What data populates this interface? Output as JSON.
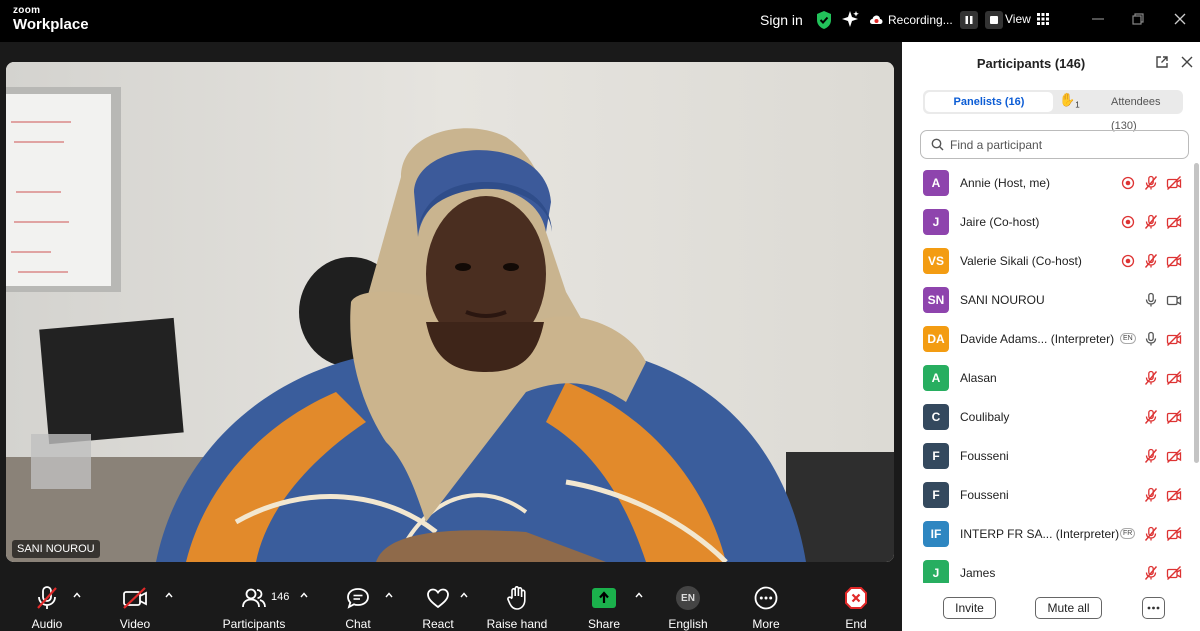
{
  "app": {
    "brand_small": "zoom",
    "brand_large": "Workplace"
  },
  "topbar": {
    "sign_in": "Sign in",
    "recording": "Recording...",
    "view": "View"
  },
  "video": {
    "speaker_name": "SANI NOUROU"
  },
  "toolbar": {
    "audio": "Audio",
    "video": "Video",
    "participants": "Participants",
    "participant_count": "146",
    "chat": "Chat",
    "react": "React",
    "raise_hand": "Raise hand",
    "share": "Share",
    "language_code": "EN",
    "language": "English",
    "more": "More",
    "end": "End"
  },
  "panel": {
    "title": "Participants (146)",
    "tab_panelists": "Panelists (16)",
    "raised_count": "1",
    "tab_attendees": "Attendees (130)",
    "search_placeholder": "Find a participant",
    "invite": "Invite",
    "mute_all": "Mute all",
    "participants": [
      {
        "initials": "A",
        "name": "Annie (Host, me)",
        "color": "#8e44ad",
        "lang": "",
        "rec": true,
        "mic": "muted",
        "cam": "off"
      },
      {
        "initials": "J",
        "name": "Jaire (Co-host)",
        "color": "#8e44ad",
        "lang": "",
        "rec": true,
        "mic": "muted",
        "cam": "off"
      },
      {
        "initials": "VS",
        "name": "Valerie Sikali (Co-host)",
        "color": "#f39c12",
        "lang": "",
        "rec": true,
        "mic": "muted",
        "cam": "off"
      },
      {
        "initials": "SN",
        "name": "SANI NOUROU",
        "color": "#8e44ad",
        "lang": "",
        "rec": false,
        "mic": "on",
        "cam": "on"
      },
      {
        "initials": "DA",
        "name": "Davide Adams...  (Interpreter)",
        "color": "#f39c12",
        "lang": "EN",
        "rec": false,
        "mic": "on",
        "cam": "off"
      },
      {
        "initials": "A",
        "name": "Alasan",
        "color": "#27ae60",
        "lang": "",
        "rec": false,
        "mic": "muted",
        "cam": "off"
      },
      {
        "initials": "C",
        "name": "Coulibaly",
        "color": "#34495e",
        "lang": "",
        "rec": false,
        "mic": "muted",
        "cam": "off"
      },
      {
        "initials": "F",
        "name": "Fousseni",
        "color": "#34495e",
        "lang": "",
        "rec": false,
        "mic": "muted",
        "cam": "off"
      },
      {
        "initials": "F",
        "name": "Fousseni",
        "color": "#34495e",
        "lang": "",
        "rec": false,
        "mic": "muted",
        "cam": "off"
      },
      {
        "initials": "IF",
        "name": "INTERP FR SA...  (Interpreter)",
        "color": "#2e86c1",
        "lang": "FR",
        "rec": false,
        "mic": "muted",
        "cam": "off"
      },
      {
        "initials": "J",
        "name": "James",
        "color": "#27ae60",
        "lang": "",
        "rec": false,
        "mic": "muted",
        "cam": "off"
      }
    ]
  },
  "colors": {
    "accent_blue": "#0b5cd5",
    "mute_red": "#e02828",
    "share_green": "#1bb14c",
    "shield_green": "#22c25a"
  }
}
